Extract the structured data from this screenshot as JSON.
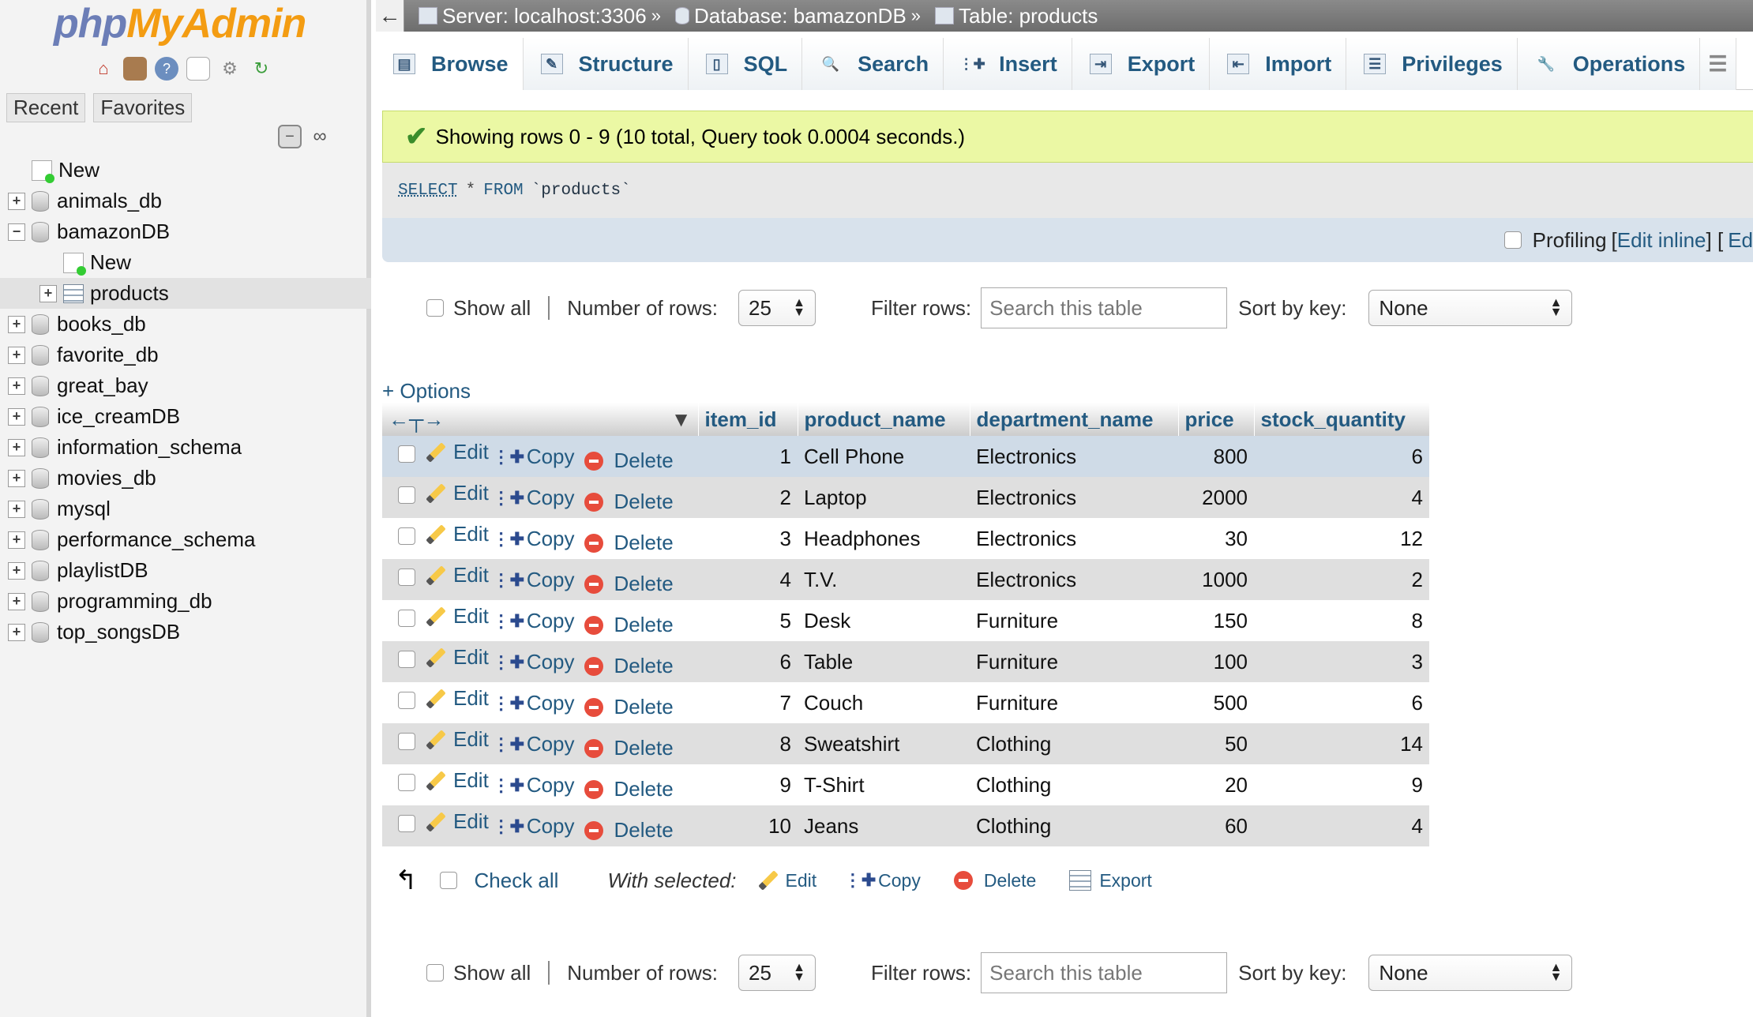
{
  "nav": {
    "logo_php": "php",
    "logo_myadmin": "MyAdmin",
    "tabs": [
      "Recent",
      "Favorites"
    ],
    "tree": [
      {
        "label": "New",
        "type": "new",
        "level": 0
      },
      {
        "label": "animals_db",
        "type": "db",
        "level": 0
      },
      {
        "label": "bamazonDB",
        "type": "db",
        "level": 0,
        "expanded": true
      },
      {
        "label": "New",
        "type": "new",
        "level": 1
      },
      {
        "label": "products",
        "type": "table",
        "level": 1,
        "selected": true
      },
      {
        "label": "books_db",
        "type": "db",
        "level": 0
      },
      {
        "label": "favorite_db",
        "type": "db",
        "level": 0
      },
      {
        "label": "great_bay",
        "type": "db",
        "level": 0
      },
      {
        "label": "ice_creamDB",
        "type": "db",
        "level": 0
      },
      {
        "label": "information_schema",
        "type": "db",
        "level": 0
      },
      {
        "label": "movies_db",
        "type": "db",
        "level": 0
      },
      {
        "label": "mysql",
        "type": "db",
        "level": 0
      },
      {
        "label": "performance_schema",
        "type": "db",
        "level": 0
      },
      {
        "label": "playlistDB",
        "type": "db",
        "level": 0
      },
      {
        "label": "programming_db",
        "type": "db",
        "level": 0
      },
      {
        "label": "top_songsDB",
        "type": "db",
        "level": 0
      }
    ]
  },
  "breadcrumb": {
    "server": "Server: localhost:3306",
    "database": "Database: bamazonDB",
    "table": "Table: products",
    "sep": "»"
  },
  "tabs": [
    "Browse",
    "Structure",
    "SQL",
    "Search",
    "Insert",
    "Export",
    "Import",
    "Privileges",
    "Operations"
  ],
  "message": "Showing rows 0 - 9 (10 total, Query took 0.0004 seconds.)",
  "sql": {
    "select": "SELECT",
    "star": "*",
    "from": "FROM",
    "table": "`products`"
  },
  "profiling": {
    "label": "Profiling",
    "open": "[",
    "edit_inline": "Edit inline",
    "close": "] [",
    "edit": "Ed"
  },
  "controls": {
    "show_all": "Show all",
    "rows_label": "Number of rows:",
    "rows_value": "25",
    "filter_label": "Filter rows:",
    "filter_placeholder": "Search this table",
    "sort_label": "Sort by key:",
    "sort_value": "None"
  },
  "options_link": "+ Options",
  "table": {
    "columns": [
      "item_id",
      "product_name",
      "department_name",
      "price",
      "stock_quantity"
    ],
    "actions": {
      "edit": "Edit",
      "copy": "Copy",
      "delete": "Delete"
    },
    "rows": [
      {
        "item_id": "1",
        "product_name": "Cell Phone",
        "department_name": "Electronics",
        "price": "800",
        "stock_quantity": "6"
      },
      {
        "item_id": "2",
        "product_name": "Laptop",
        "department_name": "Electronics",
        "price": "2000",
        "stock_quantity": "4"
      },
      {
        "item_id": "3",
        "product_name": "Headphones",
        "department_name": "Electronics",
        "price": "30",
        "stock_quantity": "12"
      },
      {
        "item_id": "4",
        "product_name": "T.V.",
        "department_name": "Electronics",
        "price": "1000",
        "stock_quantity": "2"
      },
      {
        "item_id": "5",
        "product_name": "Desk",
        "department_name": "Furniture",
        "price": "150",
        "stock_quantity": "8"
      },
      {
        "item_id": "6",
        "product_name": "Table",
        "department_name": "Furniture",
        "price": "100",
        "stock_quantity": "3"
      },
      {
        "item_id": "7",
        "product_name": "Couch",
        "department_name": "Furniture",
        "price": "500",
        "stock_quantity": "6"
      },
      {
        "item_id": "8",
        "product_name": "Sweatshirt",
        "department_name": "Clothing",
        "price": "50",
        "stock_quantity": "14"
      },
      {
        "item_id": "9",
        "product_name": "T-Shirt",
        "department_name": "Clothing",
        "price": "20",
        "stock_quantity": "9"
      },
      {
        "item_id": "10",
        "product_name": "Jeans",
        "department_name": "Clothing",
        "price": "60",
        "stock_quantity": "4"
      }
    ]
  },
  "bulk": {
    "check_all": "Check all",
    "with_selected": "With selected:",
    "edit": "Edit",
    "copy": "Copy",
    "delete": "Delete",
    "export": "Export"
  },
  "colors": {
    "link": "#235a81",
    "success_bg": "#ebf8a4",
    "row_hover": "#cfdbe7"
  }
}
